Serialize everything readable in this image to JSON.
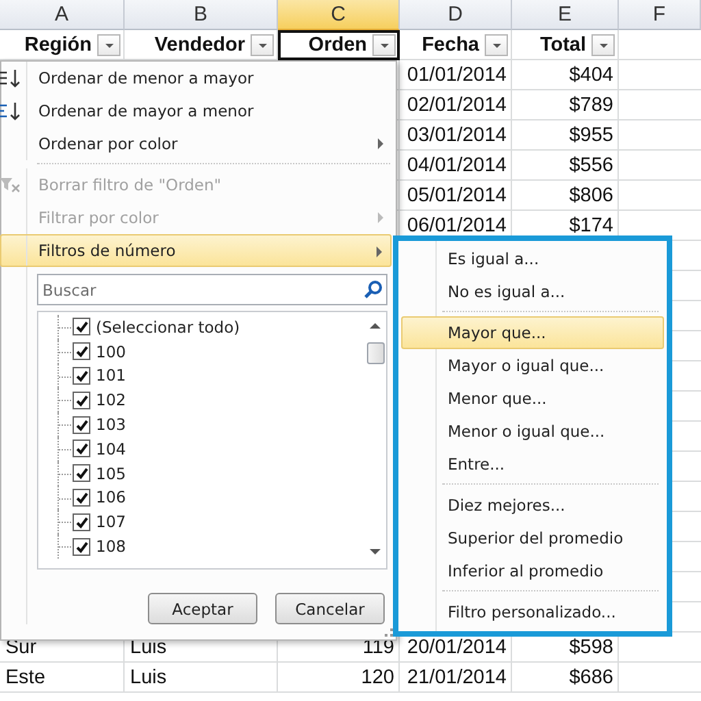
{
  "columns": [
    {
      "label": "A",
      "selected": false
    },
    {
      "label": "B",
      "selected": false
    },
    {
      "label": "C",
      "selected": true
    },
    {
      "label": "D",
      "selected": false
    },
    {
      "label": "E",
      "selected": false
    },
    {
      "label": "F",
      "selected": false
    }
  ],
  "header_row": [
    {
      "label": "Región",
      "active": false
    },
    {
      "label": "Vendedor",
      "active": false
    },
    {
      "label": "Orden",
      "active": true
    },
    {
      "label": "Fecha",
      "active": false
    },
    {
      "label": "Total",
      "active": false
    }
  ],
  "top_rows": [
    {
      "D": "01/01/2014",
      "E": "$404"
    },
    {
      "D": "02/01/2014",
      "E": "$789"
    },
    {
      "D": "03/01/2014",
      "E": "$955"
    },
    {
      "D": "04/01/2014",
      "E": "$556"
    },
    {
      "D": "05/01/2014",
      "E": "$806"
    },
    {
      "D": "06/01/2014",
      "E": "$174"
    }
  ],
  "bottom_rows": [
    {
      "A": "Sur",
      "B": "Luis",
      "C": "119",
      "D": "20/01/2014",
      "E": "$598"
    },
    {
      "A": "Este",
      "B": "Luis",
      "C": "120",
      "D": "21/01/2014",
      "E": "$686"
    }
  ],
  "filter_menu": {
    "items": [
      {
        "kind": "item",
        "label": "Ordenar de menor a mayor",
        "disabled": false,
        "submenu": false,
        "selected": false
      },
      {
        "kind": "item",
        "label": "Ordenar de mayor a menor",
        "disabled": false,
        "submenu": false,
        "selected": false
      },
      {
        "kind": "item",
        "label": "Ordenar por color",
        "disabled": false,
        "submenu": true,
        "selected": false
      },
      {
        "kind": "separator"
      },
      {
        "kind": "item",
        "label": "Borrar filtro de \"Orden\"",
        "disabled": true,
        "submenu": false,
        "selected": false
      },
      {
        "kind": "item",
        "label": "Filtrar por color",
        "disabled": true,
        "submenu": true,
        "selected": false
      },
      {
        "kind": "item",
        "label": "Filtros de número",
        "disabled": false,
        "submenu": true,
        "selected": true
      }
    ],
    "search": {
      "placeholder": "Buscar"
    },
    "values": [
      {
        "label": "(Seleccionar todo)",
        "checked": true
      },
      {
        "label": "100",
        "checked": true
      },
      {
        "label": "101",
        "checked": true
      },
      {
        "label": "102",
        "checked": true
      },
      {
        "label": "103",
        "checked": true
      },
      {
        "label": "104",
        "checked": true
      },
      {
        "label": "105",
        "checked": true
      },
      {
        "label": "106",
        "checked": true
      },
      {
        "label": "107",
        "checked": true
      },
      {
        "label": "108",
        "checked": true
      }
    ],
    "buttons": [
      "Aceptar",
      "Cancelar"
    ]
  },
  "number_filters_menu": {
    "highlighted": true,
    "items": [
      {
        "kind": "item",
        "label": "Es igual a...",
        "selected": false
      },
      {
        "kind": "item",
        "label": "No es igual a...",
        "selected": false
      },
      {
        "kind": "separator"
      },
      {
        "kind": "item",
        "label": "Mayor que...",
        "selected": true
      },
      {
        "kind": "item",
        "label": "Mayor o igual que...",
        "selected": false
      },
      {
        "kind": "item",
        "label": "Menor que...",
        "selected": false
      },
      {
        "kind": "item",
        "label": "Menor o igual que...",
        "selected": false
      },
      {
        "kind": "item",
        "label": "Entre...",
        "selected": false
      },
      {
        "kind": "separator"
      },
      {
        "kind": "item",
        "label": "Diez mejores...",
        "selected": false
      },
      {
        "kind": "item",
        "label": "Superior del promedio",
        "selected": false
      },
      {
        "kind": "item",
        "label": "Inferior al promedio",
        "selected": false
      },
      {
        "kind": "separator"
      },
      {
        "kind": "item",
        "label": "Filtro personalizado...",
        "selected": false
      }
    ]
  }
}
